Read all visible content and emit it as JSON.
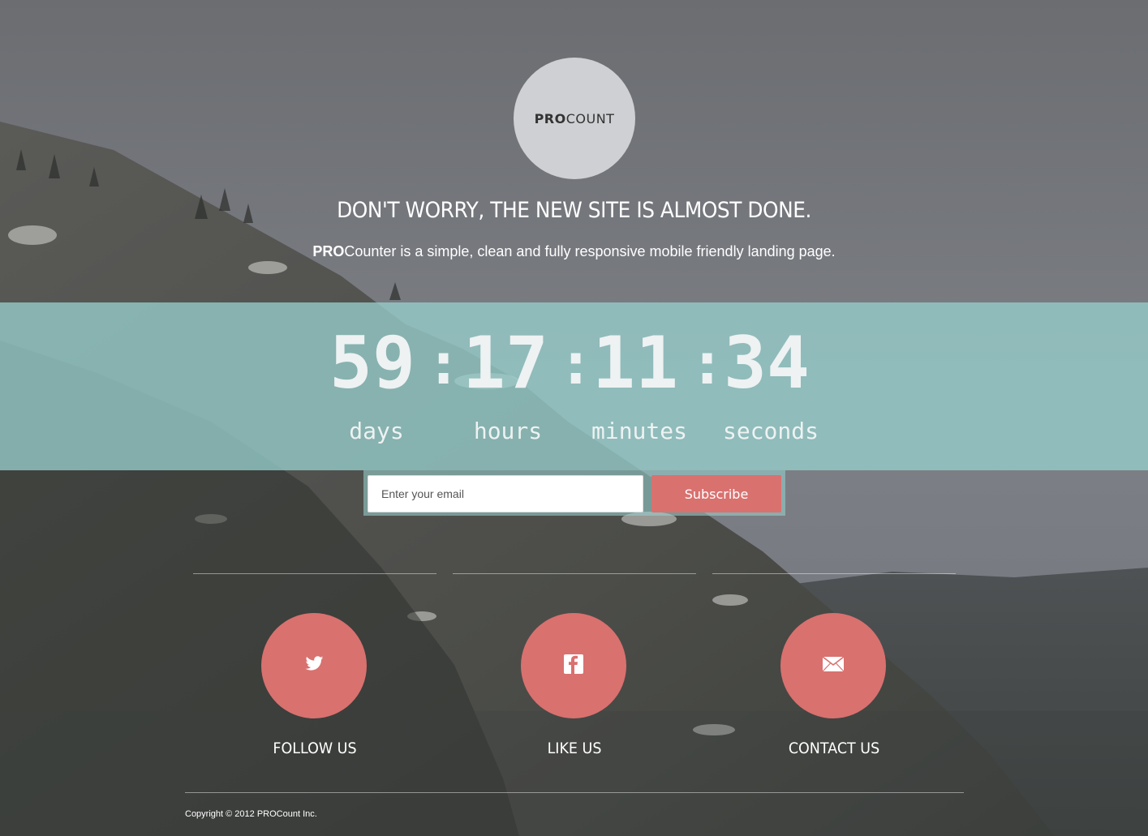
{
  "logo": {
    "bold": "PRO",
    "regular": "COUNT"
  },
  "headline": "DON'T WORRY, THE NEW SITE IS ALMOST DONE.",
  "tagline": {
    "bold": "PRO",
    "rest": "Counter is a simple, clean and fully responsive mobile friendly landing page."
  },
  "countdown": {
    "days": "59",
    "hours": "17",
    "minutes": "11",
    "seconds": "34",
    "separator": ":",
    "labels": {
      "days": "days",
      "hours": "hours",
      "minutes": "minutes",
      "seconds": "seconds"
    }
  },
  "subscribe": {
    "placeholder": "Enter your email",
    "button_label": "Subscribe"
  },
  "social": [
    {
      "icon": "twitter-icon",
      "label": "FOLLOW US"
    },
    {
      "icon": "facebook-icon",
      "label": "LIKE US"
    },
    {
      "icon": "mail-icon",
      "label": "CONTACT US"
    }
  ],
  "footer": {
    "copyright": "Copyright © 2012 PROCount Inc."
  },
  "colors": {
    "accent": "#d9716f",
    "band": "#96cdcb",
    "logo_bg": "#cfd0d3"
  }
}
